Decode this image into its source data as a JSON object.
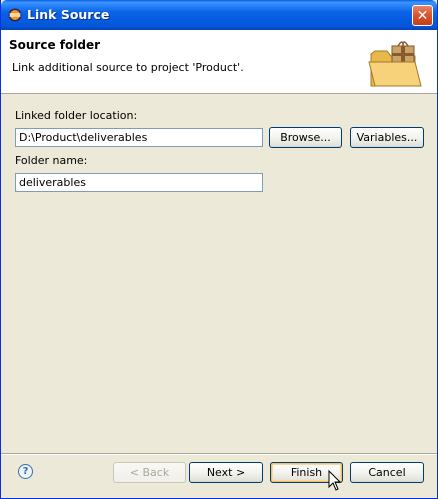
{
  "window": {
    "title": "Link Source",
    "close_label": "✕"
  },
  "banner": {
    "title": "Source folder",
    "message": "Link additional source to project 'Product'."
  },
  "form": {
    "location_label": "Linked folder location:",
    "location_value": "D:\\Product\\deliverables",
    "browse_label": "Browse...",
    "variables_label": "Variables...",
    "folder_name_label": "Folder name:",
    "folder_name_value": "deliverables"
  },
  "footer": {
    "help_label": "?",
    "back_label": "< Back",
    "next_label": "Next >",
    "finish_label": "Finish",
    "cancel_label": "Cancel"
  },
  "colors": {
    "titlebar": "#0a63e8",
    "dialog_bg": "#ece9d8",
    "button_border": "#003c74",
    "close_button": "#d9532c"
  },
  "icons": [
    "eclipse-app-icon",
    "close-icon",
    "folder-with-package-icon",
    "help-icon",
    "mouse-pointer-icon"
  ]
}
